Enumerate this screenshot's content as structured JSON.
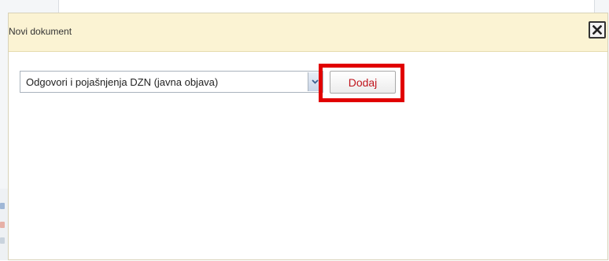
{
  "dialog": {
    "title": "Novi dokument",
    "close_icon": "close-x-icon"
  },
  "form": {
    "document_type_selected": "Odgovori i pojašnjenja DZN (javna objava)",
    "dropdown_icon": "chevron-down-icon",
    "add_label": "Dodaj"
  },
  "colors": {
    "header_background": "#fbf3d3",
    "highlight_border": "#e10000",
    "add_button_text": "#c0151d"
  }
}
